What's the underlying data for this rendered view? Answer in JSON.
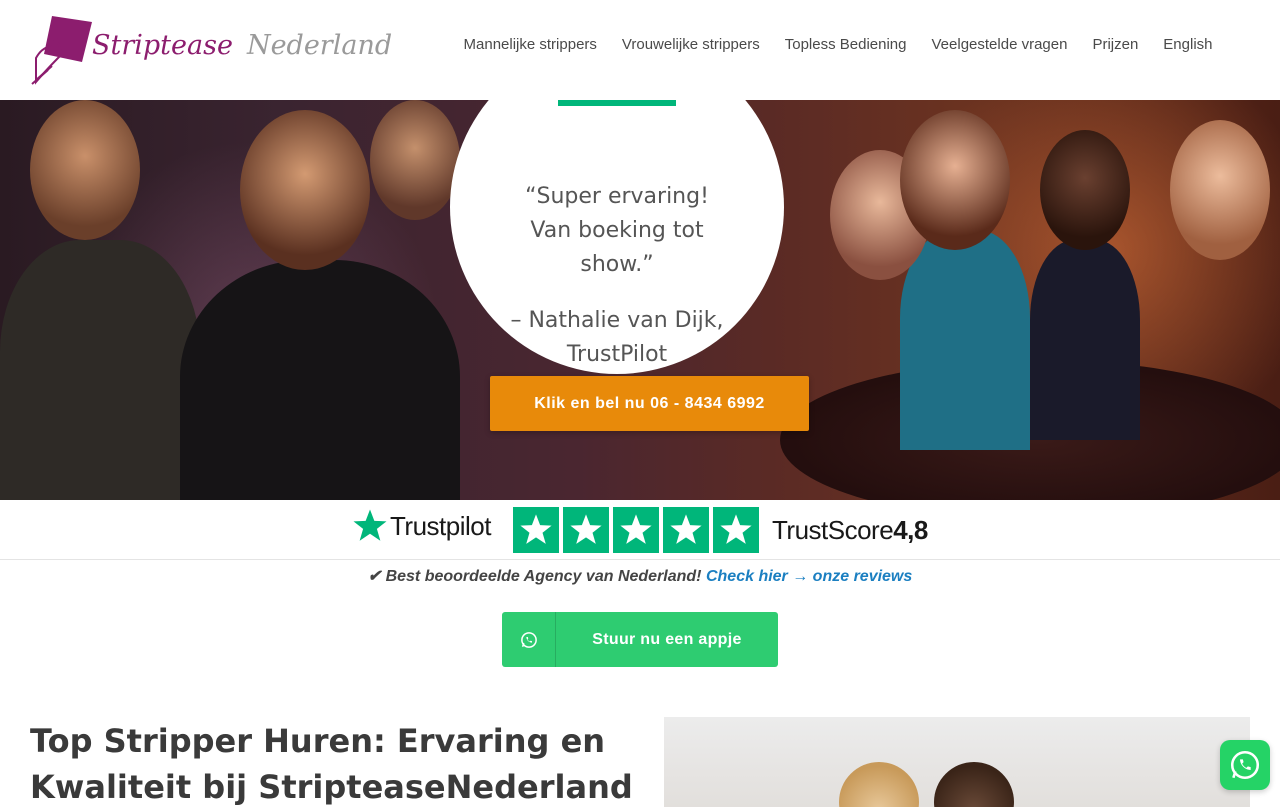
{
  "brand": {
    "logo_part1": "Striptease",
    "logo_part2": "Nederland",
    "logo_color": "#8c1d6e"
  },
  "nav": {
    "items": [
      {
        "label": "Mannelijke strippers"
      },
      {
        "label": "Vrouwelijke strippers"
      },
      {
        "label": "Topless Bediening"
      },
      {
        "label": "Veelgestelde vragen"
      },
      {
        "label": "Prijzen"
      },
      {
        "label": "English"
      }
    ]
  },
  "hero": {
    "quote_line1": "“Super ervaring!",
    "quote_line2": "Van boeking tot",
    "quote_line3": "show.”",
    "author_line1": "– Nathalie van Dijk,",
    "author_line2": "TrustPilot",
    "cta_label": "Klik en bel nu 06 - 8434 6992",
    "cta_color": "#e88a0a"
  },
  "trustpilot": {
    "brand": "Trustpilot",
    "score_label": "TrustScore",
    "score_value": "4,8",
    "stars": 5,
    "color": "#00b67a"
  },
  "reviews": {
    "prefix": "✔ Best beoordeelde Agency van Nederland!",
    "link": "Check hier → onze reviews"
  },
  "whatsapp": {
    "button_label": "Stuur nu een appje",
    "color": "#2ecc71"
  },
  "content": {
    "heading_line1": "Top Stripper Huren: Ervaring en",
    "heading_line2": "Kwaliteit bij StripteaseNederland"
  }
}
